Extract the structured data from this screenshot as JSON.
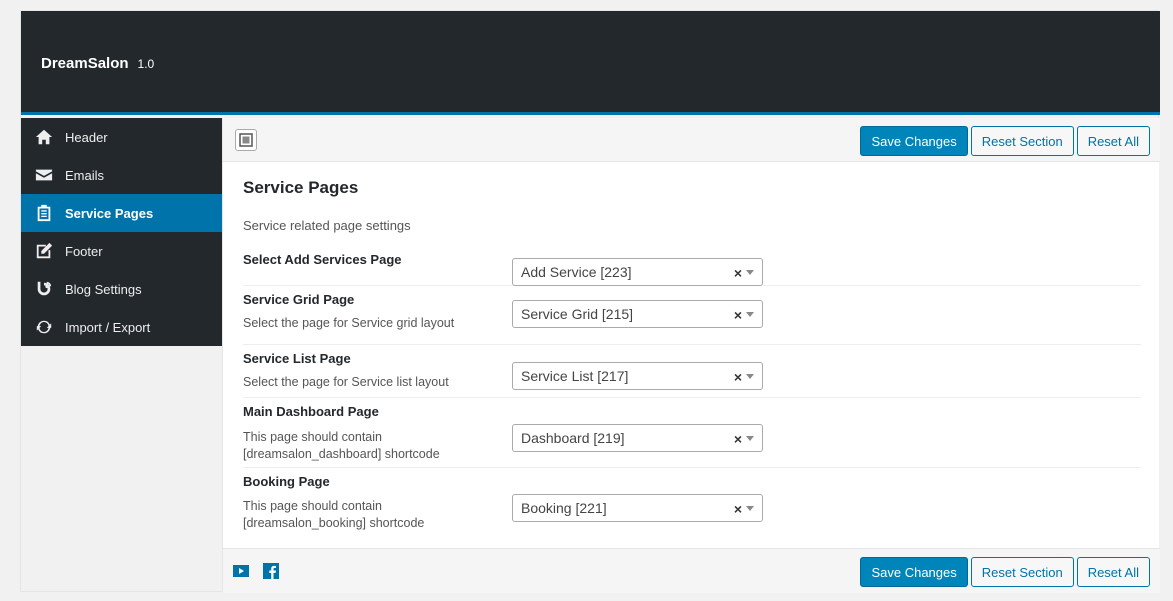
{
  "app": {
    "title": "DreamSalon",
    "version": "1.0"
  },
  "sidebar": {
    "items": [
      {
        "label": "Header",
        "icon": "home-icon"
      },
      {
        "label": "Emails",
        "icon": "envelope-icon"
      },
      {
        "label": "Service Pages",
        "icon": "clipboard-icon",
        "active": true
      },
      {
        "label": "Footer",
        "icon": "edit-icon"
      },
      {
        "label": "Blog Settings",
        "icon": "blogger-icon"
      },
      {
        "label": "Import / Export",
        "icon": "refresh-icon"
      }
    ]
  },
  "toolbar": {
    "save_label": "Save Changes",
    "reset_section_label": "Reset Section",
    "reset_all_label": "Reset All"
  },
  "section": {
    "title": "Service Pages",
    "description": "Service related page settings"
  },
  "fields": [
    {
      "label": "Select Add Services Page",
      "desc": "",
      "value": "Add Service [223]"
    },
    {
      "label": "Service Grid Page",
      "desc": "Select the page for Service grid layout",
      "value": "Service Grid [215]"
    },
    {
      "label": "Service List Page",
      "desc": "Select the page for Service list layout",
      "value": "Service List [217]"
    },
    {
      "label": "Main Dashboard Page",
      "desc": "This page should contain [dreamsalon_dashboard] shortcode",
      "value": "Dashboard [219]"
    },
    {
      "label": "Booking Page",
      "desc": "This page should contain [dreamsalon_booking] shortcode",
      "value": "Booking [221]"
    }
  ],
  "select_clear_glyph": "×",
  "colors": {
    "accent": "#0073aa",
    "dark": "#23282d",
    "primary_button": "#0085ba"
  },
  "footer": {
    "icons": [
      "youtube-icon",
      "facebook-icon"
    ]
  }
}
